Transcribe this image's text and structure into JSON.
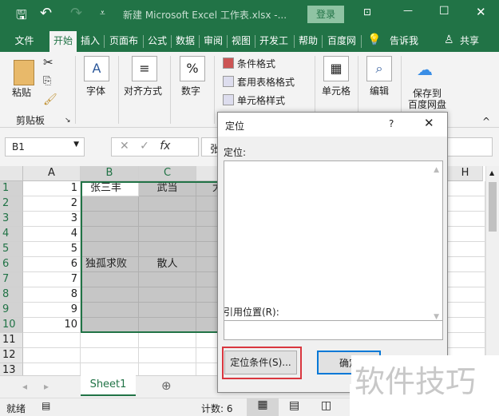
{
  "title_bar": {
    "title": "新建 Microsoft Excel 工作表.xlsx  -...",
    "login": "登录"
  },
  "tabs": [
    "文件",
    "开始",
    "插入",
    "页面布局",
    "公式",
    "数据",
    "审阅",
    "视图",
    "开发工具",
    "帮助",
    "百度网盘"
  ],
  "tell_me": "告诉我",
  "share": "共享",
  "ribbon": {
    "paste": "粘贴",
    "clipboard": "剪贴板",
    "font": "字体",
    "align": "对齐方式",
    "number": "数字",
    "cond_format": "条件格式",
    "table_format": "套用表格格式",
    "cell_style": "单元格样式",
    "cells": "单元格",
    "edit": "编辑",
    "save_baidu_1": "保存到",
    "save_baidu_2": "百度网盘"
  },
  "formula_bar": {
    "name_box": "B1",
    "value": "张"
  },
  "columns": [
    "A",
    "B",
    "C",
    "H"
  ],
  "rows": [
    "1",
    "2",
    "3",
    "4",
    "5",
    "6",
    "7",
    "8",
    "9",
    "10",
    "11",
    "12",
    "13"
  ],
  "col_a": [
    "1",
    "2",
    "3",
    "4",
    "5",
    "6",
    "7",
    "8",
    "9",
    "10"
  ],
  "col_b": {
    "r1": "张三丰",
    "r6": "独孤求败"
  },
  "col_c": {
    "r1": "武当",
    "r6": "散人"
  },
  "col_d_partial": "大",
  "sheet_tab": "Sheet1",
  "status": {
    "ready": "就绪",
    "count": "计数: 6"
  },
  "dialog": {
    "title": "定位",
    "help": "?",
    "goto_label": "定位:",
    "ref_label": "引用位置(R):",
    "special_button": "定位条件(S)...",
    "ok_button": "确定"
  },
  "watermark": "软件技巧",
  "colors": {
    "brand": "#217346",
    "highlight": "#d9363e"
  }
}
